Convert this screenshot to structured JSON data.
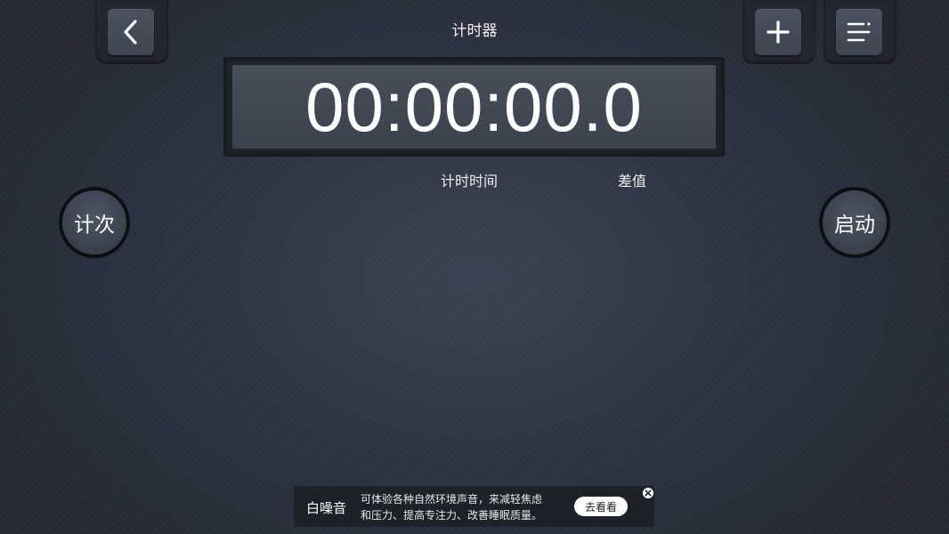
{
  "header": {
    "title": "计时器",
    "back_icon": "chevron-left-icon",
    "add_icon": "plus-icon",
    "menu_icon": "list-menu-icon"
  },
  "timer": {
    "display": "00:00:00.0",
    "columns": {
      "elapsed": "计时时间",
      "difference": "差值"
    }
  },
  "controls": {
    "lap_label": "计次",
    "start_label": "启动"
  },
  "ad": {
    "name": "白噪音",
    "text_line1": "可体验各种自然环境声音，来减轻焦虑",
    "text_line2": "和压力、提高专注力、改善睡眠质量。",
    "cta_label": "去看看",
    "close_icon": "close-icon"
  },
  "colors": {
    "background": "#2c3240",
    "button_face": "#3e4450",
    "display_panel": "#3c424d"
  }
}
